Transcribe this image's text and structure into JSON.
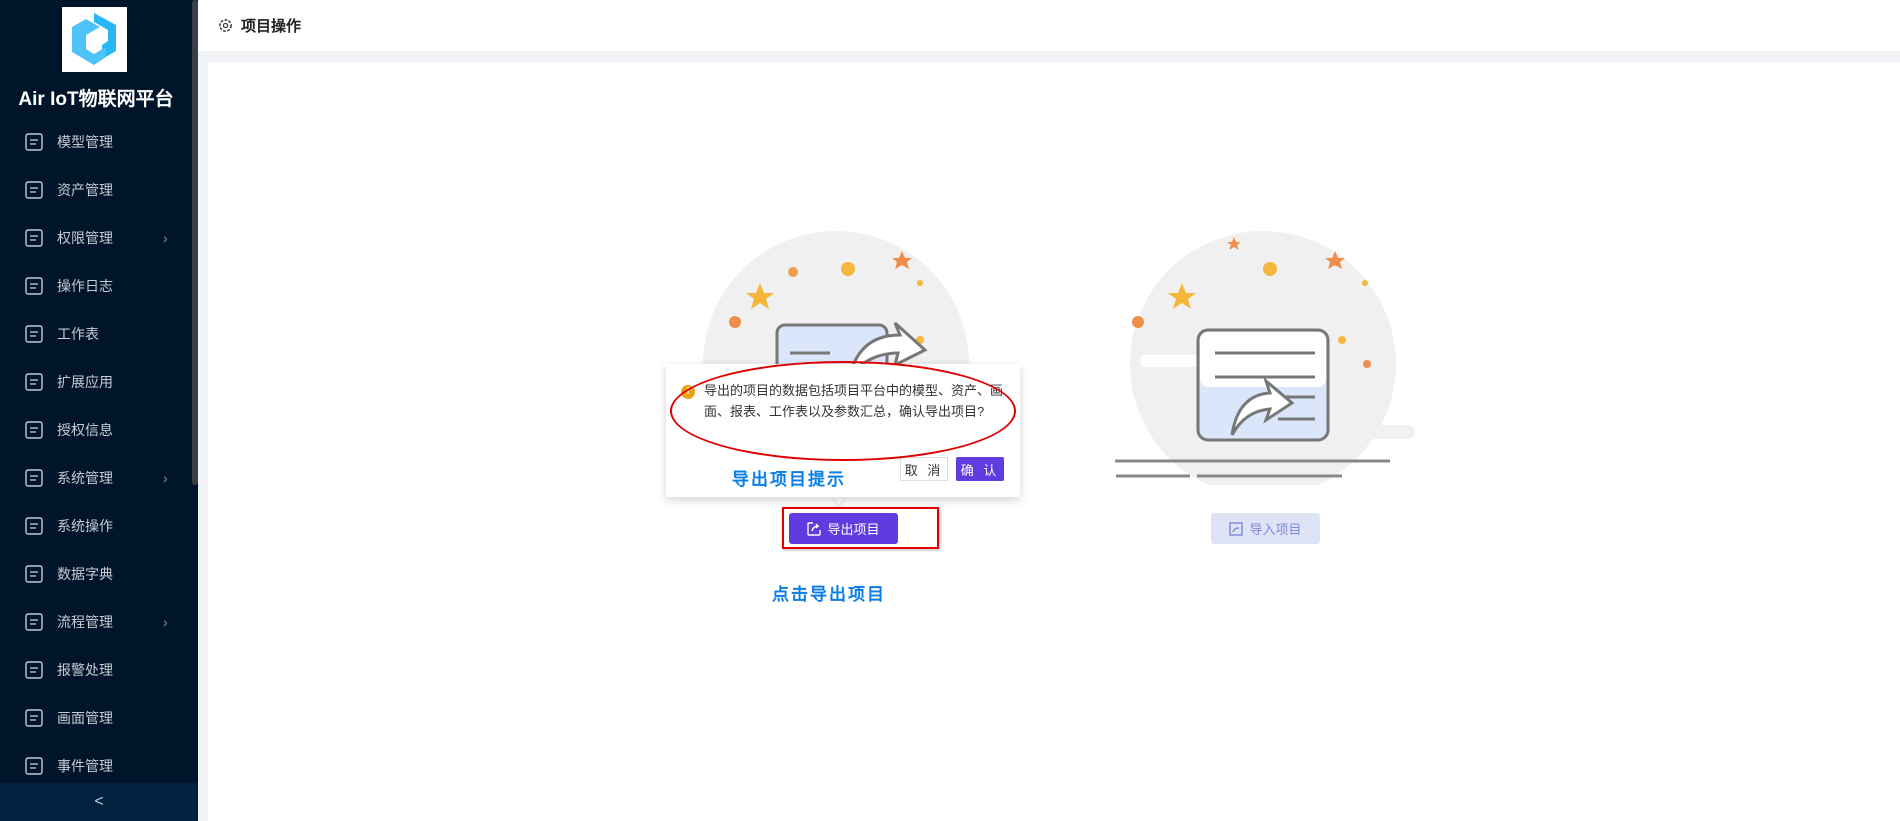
{
  "app": {
    "title": "Air IoT物联网平台",
    "logo_icon": "airiot-hex-logo"
  },
  "sidebar": {
    "items": [
      {
        "label": "模型管理",
        "icon": "model-icon",
        "chevron": false
      },
      {
        "label": "资产管理",
        "icon": "grid-icon",
        "chevron": false
      },
      {
        "label": "权限管理",
        "icon": "lock-icon",
        "chevron": true
      },
      {
        "label": "操作日志",
        "icon": "edit-log-icon",
        "chevron": false
      },
      {
        "label": "工作表",
        "icon": "notebook-icon",
        "chevron": false
      },
      {
        "label": "扩展应用",
        "icon": "clipboard-icon",
        "chevron": false
      },
      {
        "label": "授权信息",
        "icon": "license-icon",
        "chevron": false
      },
      {
        "label": "系统管理",
        "icon": "gear-icon",
        "chevron": true
      },
      {
        "label": "系统操作",
        "icon": "circles-icon",
        "chevron": false
      },
      {
        "label": "数据字典",
        "icon": "dictionary-icon",
        "chevron": false
      },
      {
        "label": "流程管理",
        "icon": "flow-icon",
        "chevron": true
      },
      {
        "label": "报警处理",
        "icon": "alarm-icon",
        "chevron": false
      },
      {
        "label": "画面管理",
        "icon": "screen-icon",
        "chevron": false
      },
      {
        "label": "事件管理",
        "icon": "event-icon",
        "chevron": false
      }
    ],
    "collapse": "<"
  },
  "header": {
    "title": "项目操作"
  },
  "main": {
    "export_button": "导出项目",
    "import_button": "导入项目",
    "click_hint": "点击导出项目"
  },
  "popconfirm": {
    "message": "导出的项目的数据包括项目平台中的模型、资产、画面、报表、工作表以及参数汇总，确认导出项目?",
    "annotation": "导出项目提示",
    "cancel": "取 消",
    "ok": "确 认"
  },
  "colors": {
    "sidebar": "#001529",
    "accent": "#5f3be0",
    "annotation": "#0a7ee8",
    "highlight": "#e00000"
  }
}
